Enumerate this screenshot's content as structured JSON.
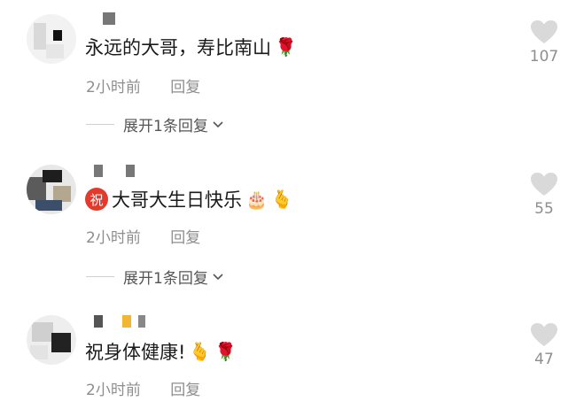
{
  "comments": [
    {
      "text": "永远的大哥，寿比南山",
      "emojis": [
        "🌹"
      ],
      "time": "2小时前",
      "reply_label": "回复",
      "expand_label": "展开1条回复",
      "likes": "107",
      "badge": null
    },
    {
      "text": "大哥大生日快乐",
      "emojis": [
        "🎂",
        "🫰"
      ],
      "time": "2小时前",
      "reply_label": "回复",
      "expand_label": "展开1条回复",
      "likes": "55",
      "badge": "祝"
    },
    {
      "text": "祝身体健康!",
      "emojis": [
        "🫰",
        "🌹"
      ],
      "time": "2小时前",
      "reply_label": "回复",
      "expand_label": null,
      "likes": "47",
      "badge": null
    }
  ],
  "icons": {
    "like": "heart-icon",
    "expand": "chevron-down-icon"
  },
  "colors": {
    "text": "#1a1a1a",
    "meta": "#8e8e8e",
    "heart": "#d9d9d9",
    "badge": "#e23b2e"
  }
}
